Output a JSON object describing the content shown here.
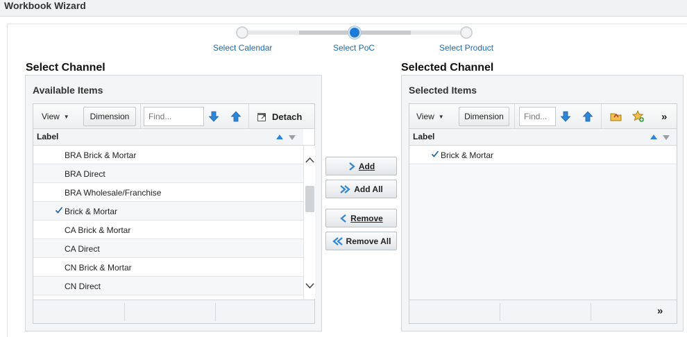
{
  "window": {
    "title": "Workbook Wizard"
  },
  "train": {
    "steps": [
      {
        "label": "Select Calendar",
        "state": "visited"
      },
      {
        "label": "Select PoC",
        "state": "current"
      },
      {
        "label": "Select Product",
        "state": "unvisited"
      }
    ]
  },
  "left": {
    "section_title": "Select Channel",
    "panel_title": "Available Items",
    "toolbar": {
      "view_label": "View",
      "dimension_label": "Dimension",
      "find_placeholder": "Find...",
      "detach_label": "Detach"
    },
    "column_header": "Label",
    "rows": [
      {
        "label": "BRA Brick & Mortar",
        "checked": false
      },
      {
        "label": "BRA Direct",
        "checked": false
      },
      {
        "label": "BRA Wholesale/Franchise",
        "checked": false
      },
      {
        "label": "Brick & Mortar",
        "checked": true
      },
      {
        "label": "CA Brick & Mortar",
        "checked": false
      },
      {
        "label": "CA Direct",
        "checked": false
      },
      {
        "label": "CN Brick & Mortar",
        "checked": false
      },
      {
        "label": "CN Direct",
        "checked": false
      }
    ]
  },
  "shuttle": {
    "add_label": "Add",
    "add_all_label": "Add All",
    "remove_label": "Remove",
    "remove_all_label": "Remove All"
  },
  "right": {
    "section_title": "Selected Channel",
    "panel_title": "Selected Items",
    "toolbar": {
      "view_label": "View",
      "dimension_label": "Dimension",
      "find_placeholder": "Find...",
      "overflow_label": "»"
    },
    "column_header": "Label",
    "rows": [
      {
        "label": "Brick & Mortar",
        "checked": true
      }
    ],
    "footer_overflow_label": "»"
  },
  "colors": {
    "accent": "#1e7bd8",
    "link": "#1c6ab0",
    "arrow_blue": "#2f86d6"
  }
}
